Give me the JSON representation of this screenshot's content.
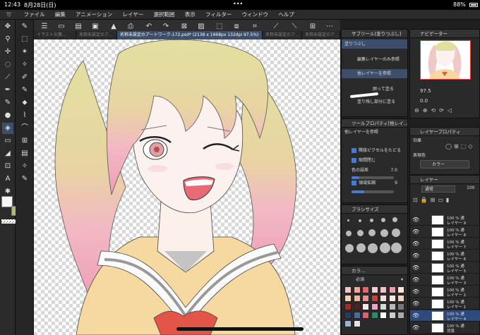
{
  "status": {
    "time": "12:43",
    "date": "8月28日(日)",
    "dots": "•••",
    "battery": "88%"
  },
  "menu": [
    "ファイル",
    "編集",
    "アニメーション",
    "レイヤー",
    "選択範囲",
    "表示",
    "フィルター",
    "ウィンドウ",
    "ヘルプ"
  ],
  "tabs": [
    "イラスト3(第...",
    "名称未設定のア...",
    "名称未設定のアートワーク-172.psd* (2138 x 1668px 132dpi 97.5%)",
    "名称未設定のア...",
    "名称未設定のア..."
  ],
  "subtool": {
    "title": "サブツール[塗りつぶし]",
    "items": [
      "塗りつぶし",
      "編集レイヤーのみ参照",
      "他レイヤーを参照",
      "囲って塗る",
      "塗り残し部分に塗る"
    ]
  },
  "navigator": {
    "title": "ナビゲーター",
    "zoom": "97.5",
    "angle": "0.0"
  },
  "toolprop": {
    "title": "ツールプロパティ[他レイ...",
    "subtitle": "他レイヤーを参照",
    "opt1": "隣接ピクセルをたどる",
    "opt2": "隙間閉じ",
    "opt3": "色の誤差",
    "opt3_val": "7.0",
    "opt4": "領域拡縮",
    "opt4_val": "9"
  },
  "layerprop": {
    "title": "レイヤープロパティ",
    "effect": "効果",
    "expr": "表現色",
    "expr_val": "カラー"
  },
  "brushsize": {
    "title": "ブラシサイズ"
  },
  "color": {
    "title": "カラ...",
    "set": "必須"
  },
  "layers": {
    "title": "レイヤー",
    "blend": "通常",
    "opacity": "100",
    "rows": [
      {
        "pct": "100 % 通",
        "name": "レイヤー 9"
      },
      {
        "pct": "100 % 通",
        "name": "レイヤー 8"
      },
      {
        "pct": "100 % 通",
        "name": "レイヤー 7"
      },
      {
        "pct": "100 % 通",
        "name": "レイヤー 6"
      },
      {
        "pct": "100 % 通",
        "name": "レイヤー 5"
      },
      {
        "pct": "100 % 通",
        "name": "レイヤー 3"
      },
      {
        "pct": "100 % 通",
        "name": "レイヤー 2"
      },
      {
        "pct": "100 % 通",
        "name": "レイヤー 1"
      },
      {
        "pct": "100 % 通",
        "name": "レイヤー 4"
      },
      {
        "pct": "100 % 通",
        "name": "背景"
      }
    ]
  },
  "colors": {
    "accent": "#4a7bd0",
    "main": "#f5f5f5",
    "sub": "#a9c26a"
  }
}
